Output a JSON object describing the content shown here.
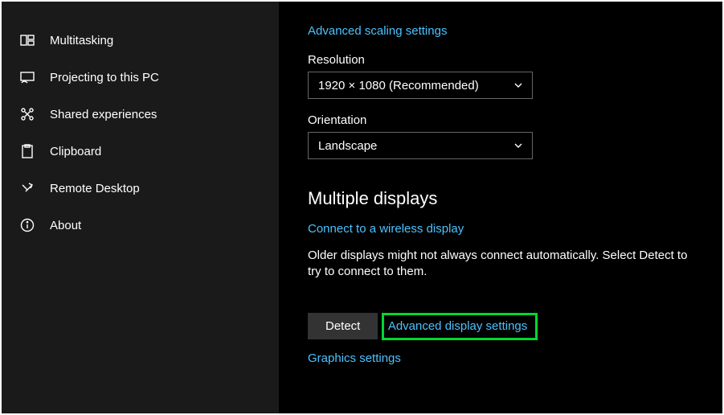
{
  "sidebar": {
    "items": [
      {
        "label": "Multitasking"
      },
      {
        "label": "Projecting to this PC"
      },
      {
        "label": "Shared experiences"
      },
      {
        "label": "Clipboard"
      },
      {
        "label": "Remote Desktop"
      },
      {
        "label": "About"
      }
    ]
  },
  "main": {
    "advanced_scaling_link": "Advanced scaling settings",
    "resolution": {
      "label": "Resolution",
      "value": "1920 × 1080 (Recommended)"
    },
    "orientation": {
      "label": "Orientation",
      "value": "Landscape"
    },
    "multiple_displays": {
      "header": "Multiple displays",
      "connect_link": "Connect to a wireless display",
      "description": "Older displays might not always connect automatically. Select Detect to try to connect to them.",
      "detect_button": "Detect"
    },
    "advanced_display_link": "Advanced display settings",
    "graphics_link": "Graphics settings"
  }
}
